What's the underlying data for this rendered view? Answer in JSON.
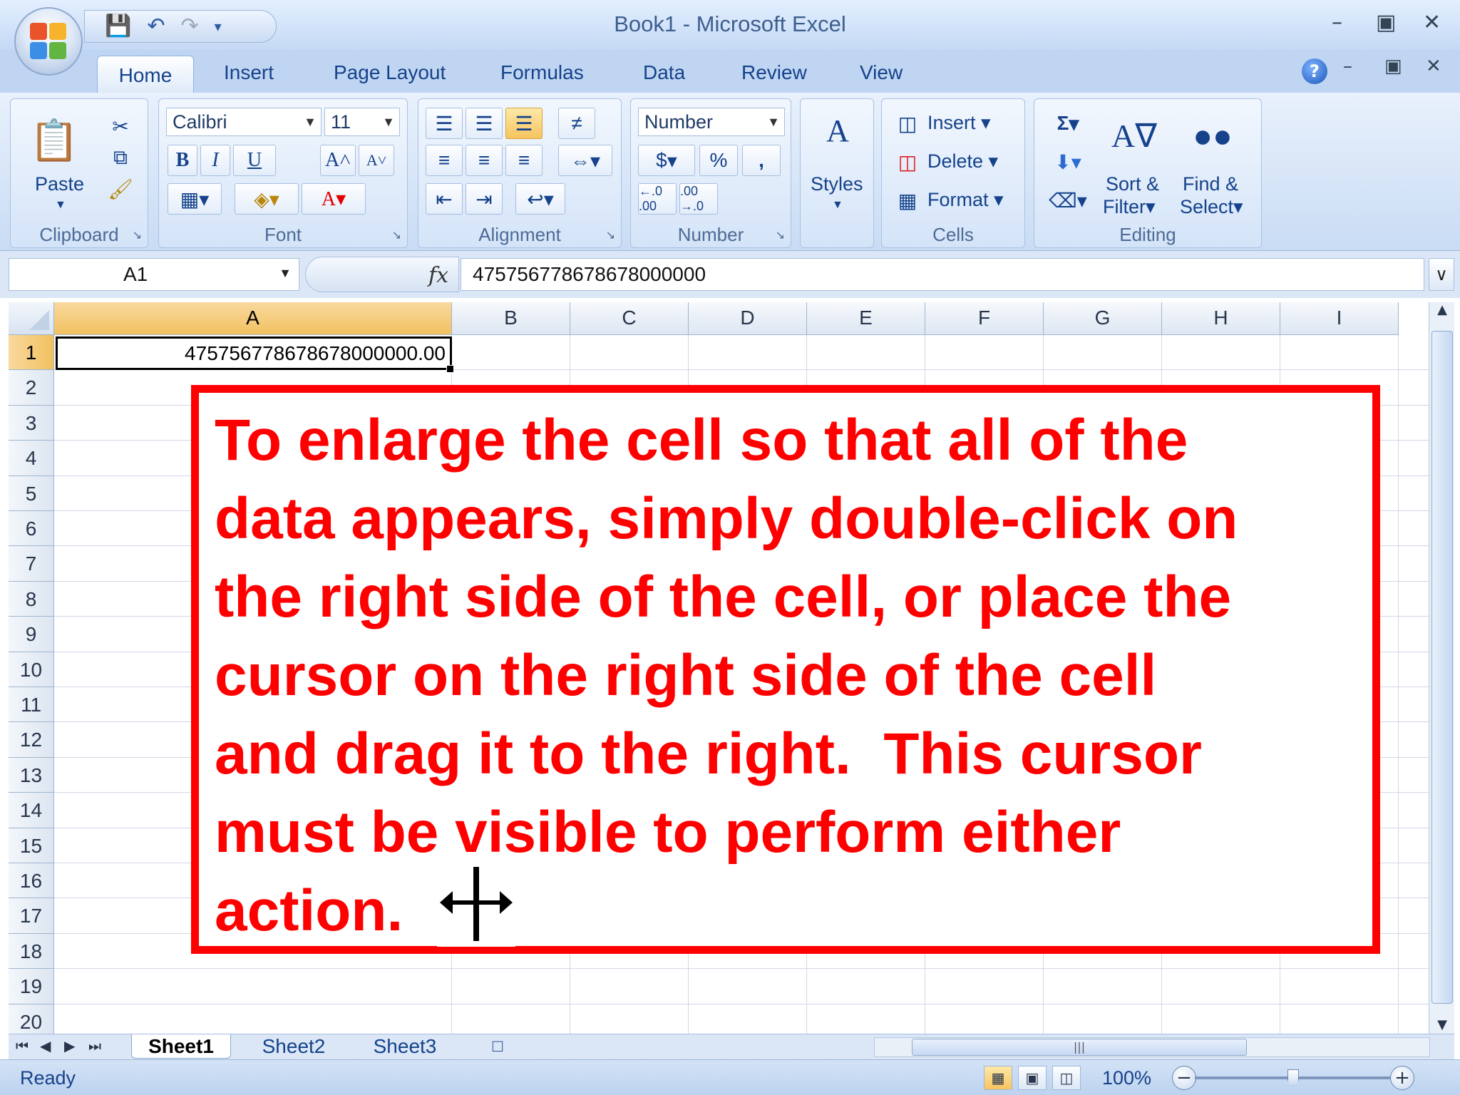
{
  "window": {
    "title": "Book1 - Microsoft Excel"
  },
  "quick_access": [
    "save-icon",
    "undo-icon",
    "redo-icon",
    "customize-icon"
  ],
  "ribbon_tabs": [
    "Home",
    "Insert",
    "Page Layout",
    "Formulas",
    "Data",
    "Review",
    "View"
  ],
  "ribbon": {
    "clipboard": {
      "label": "Clipboard",
      "paste": "Paste"
    },
    "font": {
      "label": "Font",
      "name": "Calibri",
      "size": "11",
      "bold": "B",
      "italic": "I",
      "underline": "U"
    },
    "alignment": {
      "label": "Alignment"
    },
    "number": {
      "label": "Number",
      "format": "Number",
      "currency": "$",
      "percent": "%",
      "comma": ",",
      "inc_decimal": "←.0 .00",
      "dec_decimal": ".00 →.0"
    },
    "styles": {
      "label": "Styles"
    },
    "cells": {
      "label": "Cells",
      "insert": "Insert",
      "delete": "Delete",
      "format": "Format"
    },
    "editing": {
      "label": "Editing",
      "sum": "Σ",
      "sort_line1": "Sort &",
      "sort_line2": "Filter",
      "find_line1": "Find &",
      "find_line2": "Select"
    }
  },
  "formula_bar": {
    "name_box": "A1",
    "fx": "fx",
    "value": "475756778678678000000"
  },
  "columns": [
    "A",
    "B",
    "C",
    "D",
    "E",
    "F",
    "G",
    "H",
    "I"
  ],
  "rows": [
    "1",
    "2",
    "3",
    "4",
    "5",
    "6",
    "7",
    "8",
    "9",
    "10",
    "11",
    "12",
    "13",
    "14",
    "15",
    "16",
    "17",
    "18",
    "19",
    "20"
  ],
  "cell_a1": "475756778678678000000.00",
  "callout": "To enlarge the cell so that all of the\ndata appears, simply double-click on\nthe right side of the cell, or place the\ncursor on the right side of the cell\nand drag it to the right.  This cursor\nmust be visible to perform either\naction.",
  "sheets": [
    "Sheet1",
    "Sheet2",
    "Sheet3"
  ],
  "active_sheet": "Sheet1",
  "status": {
    "text": "Ready",
    "zoom": "100%",
    "zoom_level_percent": 100
  },
  "colors": {
    "callout_red": "#ff0000",
    "ribbon_blue": "#15428b",
    "selection_orange": "#f1c15f"
  }
}
